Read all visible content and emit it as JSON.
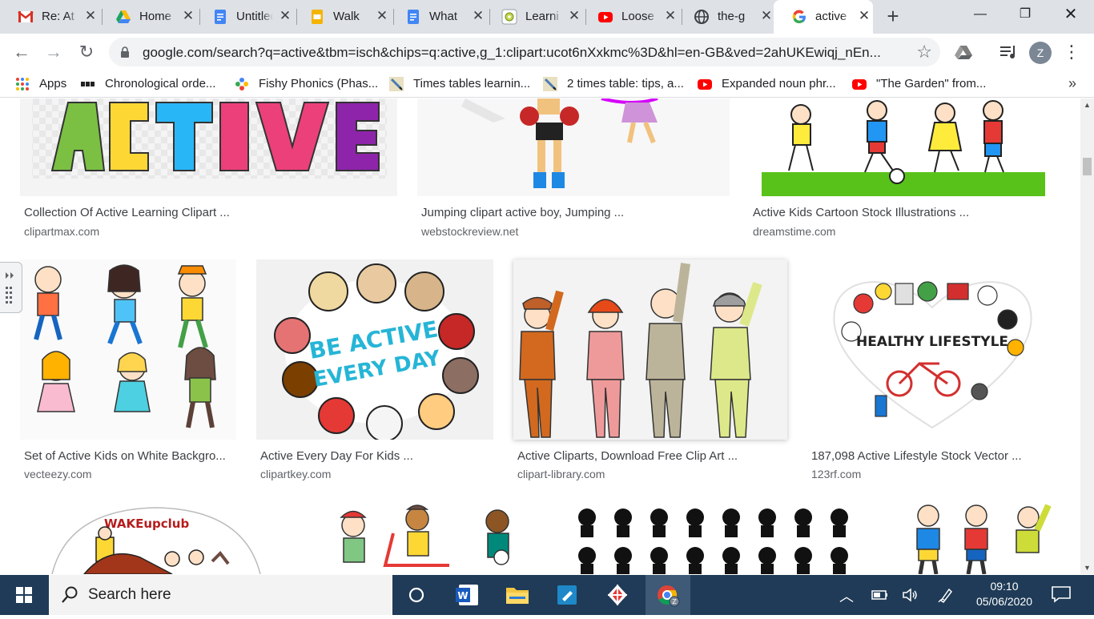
{
  "tabs": [
    {
      "title": "Re: At",
      "icon": "gmail-icon",
      "close": "✕"
    },
    {
      "title": "Home",
      "icon": "google-drive-icon",
      "close": "✕"
    },
    {
      "title": "Untitled",
      "icon": "google-docs-icon",
      "close": "✕"
    },
    {
      "title": "Walk",
      "icon": "google-slides-icon",
      "close": "✕"
    },
    {
      "title": "What",
      "icon": "google-docs-icon",
      "close": "✕"
    },
    {
      "title": "Learni",
      "icon": "learning-site-icon",
      "close": "✕"
    },
    {
      "title": "Loose",
      "icon": "youtube-icon",
      "close": "✕"
    },
    {
      "title": "the-g",
      "icon": "globe-icon",
      "close": "✕"
    },
    {
      "title": "active",
      "icon": "google-icon",
      "close": "✕",
      "active": true
    }
  ],
  "newtab_label": "+",
  "window_controls": {
    "minimize": "—",
    "maximize": "❐",
    "close": "✕"
  },
  "toolbar": {
    "back": "←",
    "forward": "→",
    "reload": "↻",
    "url": "google.com/search?q=active&tbm=isch&chips=q:active,g_1:clipart:ucot6nXxkmc%3D&hl=en-GB&ved=2ahUKEwiqj_nEn...",
    "star": "☆",
    "profile_initial": "Z",
    "menu": "⋮"
  },
  "bookmarks": [
    {
      "label": "Apps",
      "icon": "apps-grid-icon"
    },
    {
      "label": "Chronological orde...",
      "icon": "bbc-icon"
    },
    {
      "label": "Fishy Phonics (Phas...",
      "icon": "flower-icon"
    },
    {
      "label": "Times tables learnin...",
      "icon": "pencil-icon"
    },
    {
      "label": "2 times table: tips, a...",
      "icon": "pencil-icon"
    },
    {
      "label": "Expanded noun phr...",
      "icon": "youtube-icon"
    },
    {
      "label": "\"The Garden\" from...",
      "icon": "youtube-icon"
    }
  ],
  "bookmarks_more": "»",
  "results": [
    {
      "caption": "Collection Of Active Learning Clipart ...",
      "source": "clipartmax.com",
      "image": "active-letters-clipart"
    },
    {
      "caption": "Jumping clipart active boy, Jumping ...",
      "source": "webstockreview.net",
      "image": "boxing-boy-clipart"
    },
    {
      "caption": "Active Kids Cartoon Stock Illustrations ...",
      "source": "dreamstime.com",
      "image": "kids-playing-football-clipart"
    },
    {
      "caption": "Set of Active Kids on White Backgro...",
      "source": "vecteezy.com",
      "image": "jumping-kids-clipart"
    },
    {
      "caption": "Active Every Day For Kids ...",
      "source": "clipartkey.com",
      "image": "be-active-every-day-clipart"
    },
    {
      "caption": "Active Cliparts, Download Free Clip Art ...",
      "source": "clipart-library.com",
      "image": "family-stretching-clipart"
    },
    {
      "caption": "187,098 Active Lifestyle Stock Vector ...",
      "source": "123rf.com",
      "image": "healthy-lifestyle-heart-clipart"
    },
    {
      "caption": "",
      "source": "",
      "image": "wake-up-club-clipart"
    },
    {
      "caption": "",
      "source": "",
      "image": "kids-scooter-clipart"
    },
    {
      "caption": "",
      "source": "",
      "image": "kids-silhouettes-clipart"
    },
    {
      "caption": "",
      "source": "",
      "image": "elderly-exercise-clipart"
    }
  ],
  "image_text": {
    "active_letters": "ACTIVE",
    "be_active": "BE ACTIVE",
    "every_day": "EVERY DAY",
    "healthy": "HEALTHY LIFESTYLE",
    "wake": "WAKEupclub"
  },
  "taskbar": {
    "search_placeholder": "Search here",
    "time": "09:10",
    "date": "05/06/2020"
  }
}
